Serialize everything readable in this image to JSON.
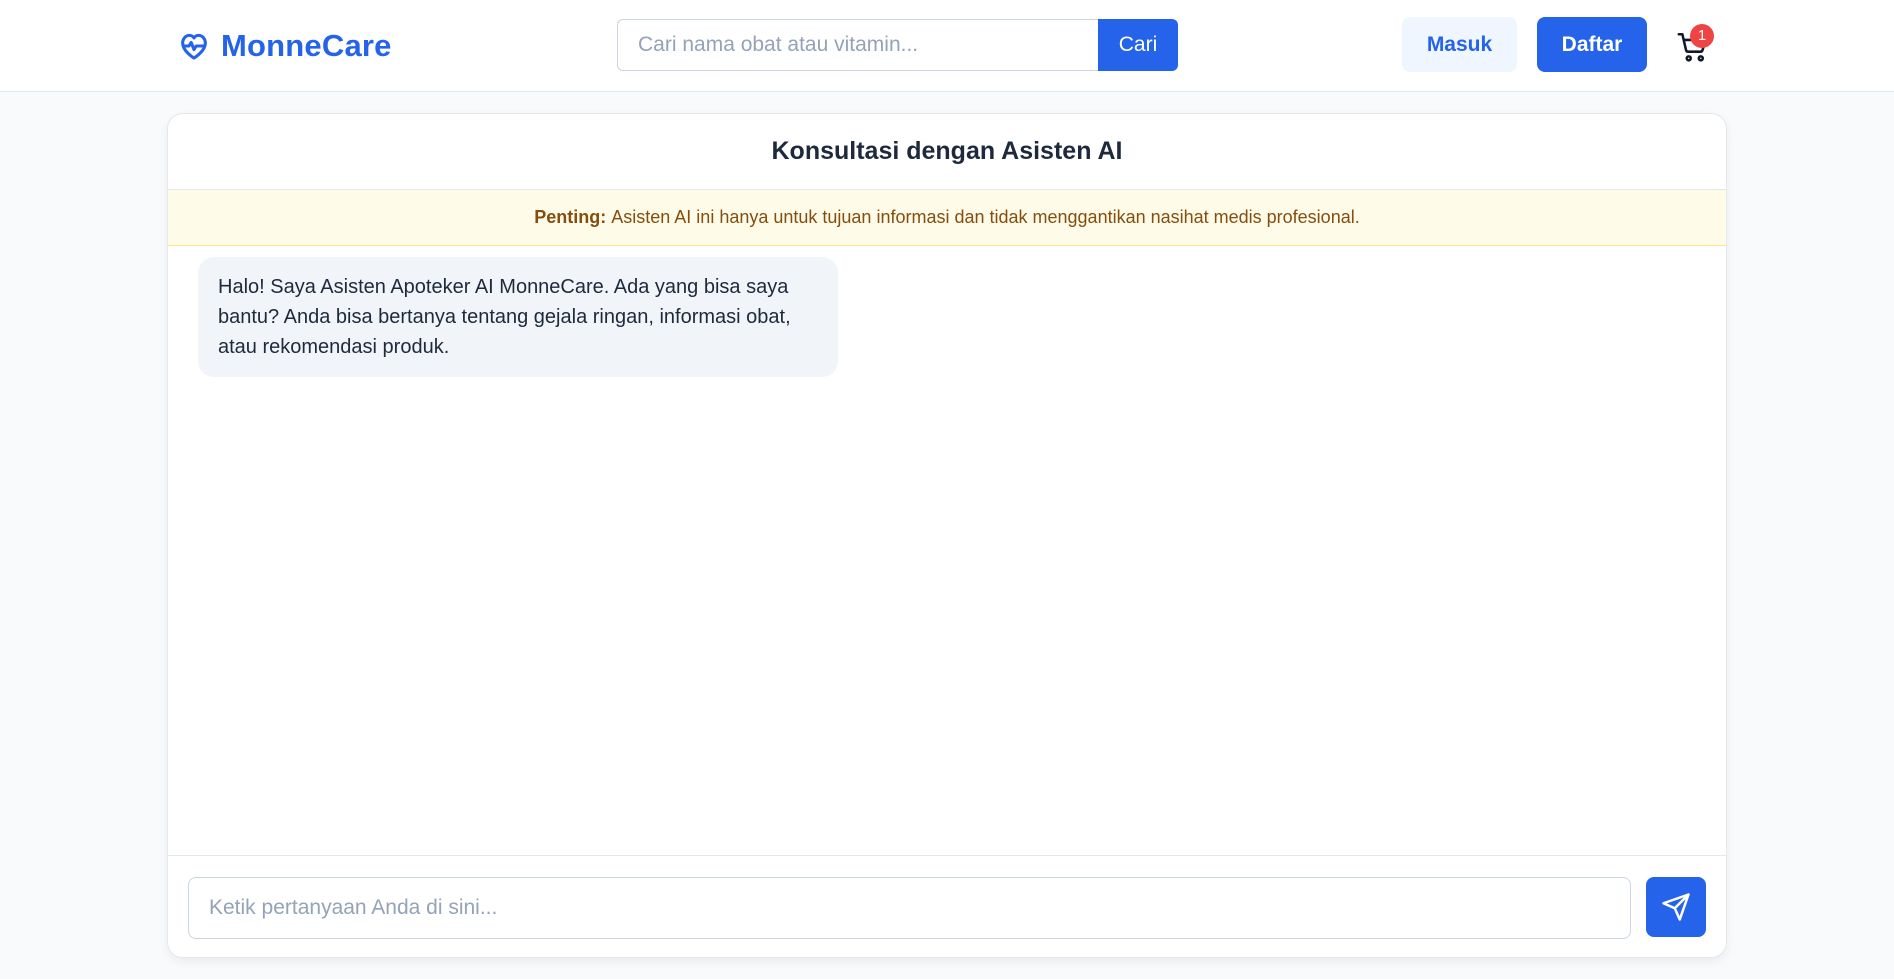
{
  "brand": {
    "name": "MonneCare",
    "logo_icon": "heart-pulse-icon",
    "color": "#2563eb"
  },
  "search": {
    "placeholder": "Cari nama obat atau vitamin...",
    "value": "",
    "button_label": "Cari"
  },
  "header": {
    "login_label": "Masuk",
    "register_label": "Daftar",
    "cart_icon": "cart-icon",
    "cart_count": "1"
  },
  "chat": {
    "title": "Konsultasi dengan Asisten AI",
    "notice_label": "Penting:",
    "notice_text": "Asisten AI ini hanya untuk tujuan informasi dan tidak menggantikan nasihat medis profesional.",
    "messages": [
      {
        "sender": "assistant",
        "text": "Halo! Saya Asisten Apoteker AI MonneCare. Ada yang bisa saya bantu? Anda bisa bertanya tentang gejala ringan, informasi obat, atau rekomendasi produk."
      }
    ],
    "input_placeholder": "Ketik pertanyaan Anda di sini...",
    "input_value": "",
    "send_icon": "send-icon"
  },
  "colors": {
    "primary": "#2563eb",
    "badge": "#ef4444",
    "notice_bg": "#fefce8",
    "notice_text": "#854d0e",
    "bubble_bg": "#f1f5f9"
  }
}
